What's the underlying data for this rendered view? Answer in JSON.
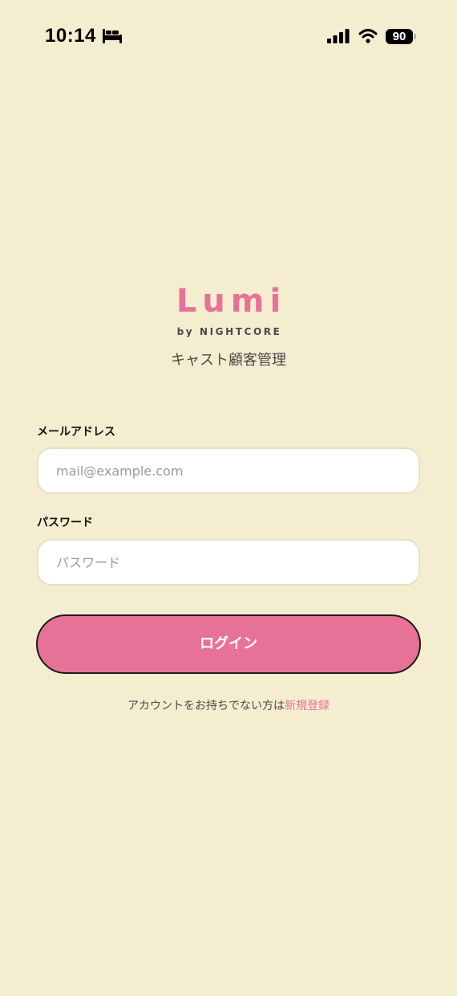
{
  "status_bar": {
    "time": "10:14",
    "battery": "90",
    "icons": [
      "bed-icon",
      "cellular-signal-icon",
      "wifi-icon",
      "battery-icon"
    ]
  },
  "brand": {
    "logo": "Lumi",
    "subtitle": "by NIGHTCORE",
    "tagline": "キャスト顧客管理"
  },
  "form": {
    "email_label": "メールアドレス",
    "email_placeholder": "mail@example.com",
    "email_value": "",
    "password_label": "パスワード",
    "password_placeholder": "パスワード",
    "password_value": "",
    "login_label": "ログイン"
  },
  "signup": {
    "prompt": "アカウントをお持ちでない方は",
    "link_label": "新規登録"
  },
  "colors": {
    "background": "#f5edcf",
    "accent": "#e77298",
    "field_border": "#e6e0c8"
  }
}
